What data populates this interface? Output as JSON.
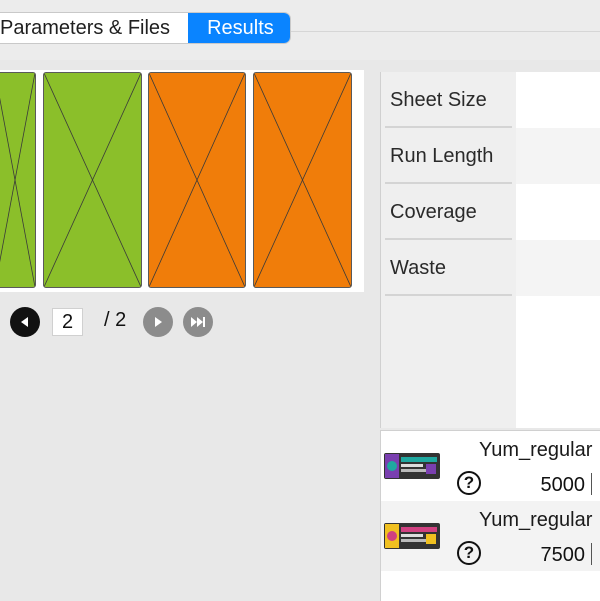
{
  "tabs": [
    {
      "label": "Parameters & Files",
      "active": false
    },
    {
      "label": "Results",
      "active": true
    }
  ],
  "preview": {
    "sheets": [
      {
        "color": "#8bbf2a"
      },
      {
        "color": "#8bbf2a"
      },
      {
        "color": "#f07d0a"
      },
      {
        "color": "#f07d0a"
      }
    ]
  },
  "pager": {
    "current_page": "2",
    "total_label": "/ 2",
    "prev_icon": "prev-icon",
    "next_icon": "next-icon",
    "last_icon": "last-icon"
  },
  "info": {
    "rows": [
      {
        "label": "Sheet Size"
      },
      {
        "label": "Run Length"
      },
      {
        "label": "Coverage"
      },
      {
        "label": "Waste"
      }
    ]
  },
  "files": [
    {
      "name": "Yum_regular",
      "quantity": "5000",
      "help": "?",
      "thumb_colors": [
        "#7a3fb0",
        "#1fa8a0",
        "#333"
      ]
    },
    {
      "name": "Yum_regular",
      "quantity": "7500",
      "help": "?",
      "thumb_colors": [
        "#f0c020",
        "#d04080",
        "#333"
      ]
    }
  ]
}
